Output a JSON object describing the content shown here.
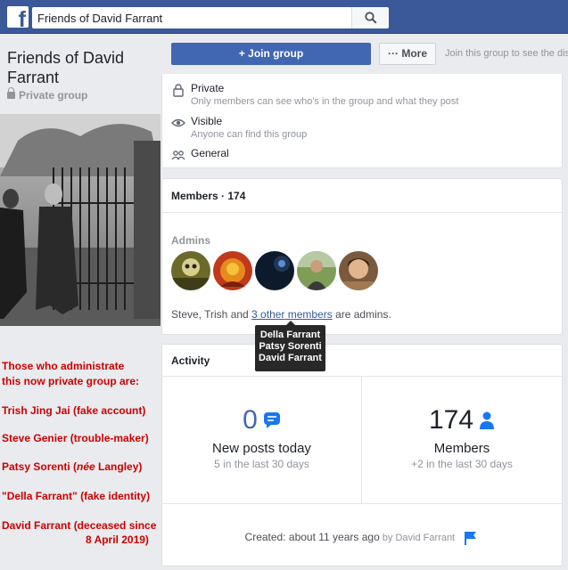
{
  "topbar": {
    "logo": "f",
    "search_value": "Friends of David Farrant",
    "search_icon": "search-icon"
  },
  "group": {
    "title": "Friends of David Farrant",
    "privacy": "Private group"
  },
  "actions": {
    "join_label": "+ Join group",
    "more_label": "··· More",
    "join_hint": "Join this group to see the dis"
  },
  "about": {
    "private_title": "Private",
    "private_desc": "Only members can see who's in the group and what they post",
    "visible_title": "Visible",
    "visible_desc": "Anyone can find this group",
    "category": "General"
  },
  "members": {
    "header": "Members · 174",
    "admins_label": "Admins",
    "admins_prefix": "Steve, Trish and ",
    "admins_link": "3 other members",
    "admins_suffix": " are admins.",
    "tooltip": [
      "Della Farrant",
      "Patsy Sorenti",
      "David Farrant"
    ]
  },
  "annotations": {
    "line1": "Those who administrate",
    "line2": "this now private group are:",
    "trish": "Trish Jing Jai (fake account)",
    "steve": "Steve Genier (trouble-maker)",
    "patsy_pre": "Patsy Sorenti (",
    "patsy_nee": "née",
    "patsy_post": " Langley)",
    "della": "\"Della Farrant\" (fake identity)",
    "david1": "David Farrant (deceased since",
    "david2": "8 April 2019)"
  },
  "activity": {
    "header": "Activity",
    "posts_value": "0",
    "posts_title": "New posts today",
    "posts_sub": "5 in the last 30 days",
    "members_value": "174",
    "members_title": "Members",
    "members_sub": "+2 in the last 30 days",
    "created_text": "Created: about 11 years ago",
    "created_by": " by David Farrant"
  },
  "colors": {
    "brand": "#3b5998",
    "button": "#4267b2",
    "annotation": "#cc0000"
  }
}
